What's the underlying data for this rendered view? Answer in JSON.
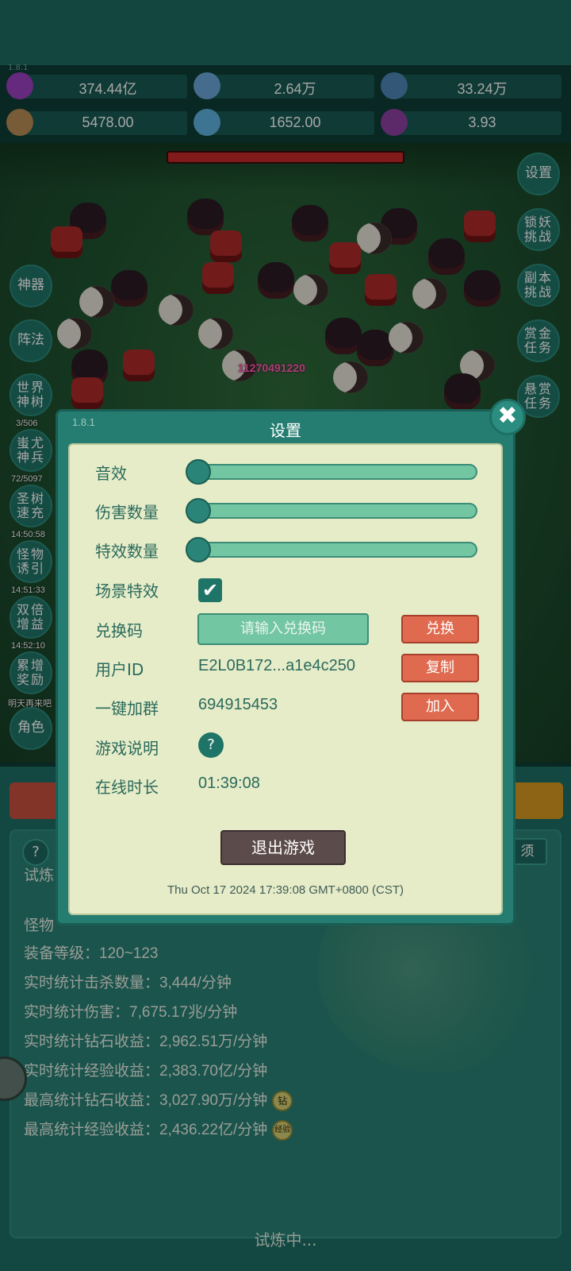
{
  "top": {
    "version": "1.8.1",
    "resources": [
      {
        "icon": "purple-gem-icon",
        "value": "374.44亿",
        "color": "#9b3fc1"
      },
      {
        "icon": "blue-crystal-icon",
        "value": "2.64万",
        "color": "#6aa6d8"
      },
      {
        "icon": "blue-orb-icon",
        "value": "33.24万",
        "color": "#4f86b5"
      },
      {
        "icon": "scroll-icon",
        "value": "5478.00",
        "color": "#b98d55"
      },
      {
        "icon": "ice-shard-icon",
        "value": "1652.00",
        "color": "#5fb3e0"
      },
      {
        "icon": "potion-icon",
        "value": "3.93",
        "color": "#8e3fa1"
      }
    ]
  },
  "field": {
    "damage_text": "11270491220",
    "boss_hp_fraction": 1.0
  },
  "left_menu": [
    {
      "label": "神器"
    },
    {
      "label": "阵法"
    },
    {
      "label": "世界神树",
      "sub": "3/506"
    },
    {
      "label": "蚩尤神兵",
      "sub": "72/5097"
    },
    {
      "label": "圣树速充",
      "sub": "14:50:58"
    },
    {
      "label": "怪物诱引",
      "sub": "14:51:33"
    },
    {
      "label": "双倍增益",
      "sub": "14:52:10"
    },
    {
      "label": "累增奖励",
      "sub": "明天再来吧"
    },
    {
      "label": "角色"
    }
  ],
  "right_menu": [
    {
      "label": "设置"
    },
    {
      "label": "锁妖挑战"
    },
    {
      "label": "副本挑战"
    },
    {
      "label": "赏金任务"
    },
    {
      "label": "悬赏任务"
    }
  ],
  "dialog": {
    "version": "1.8.1",
    "title": "设置",
    "sound_label": "音效",
    "sound_level": 0,
    "damage_count_label": "伤害数量",
    "damage_count_level": 0,
    "effect_count_label": "特效数量",
    "effect_count_level": 0,
    "scene_effect_label": "场景特效",
    "scene_effect_checked": true,
    "redeem_label": "兑换码",
    "redeem_placeholder": "请输入兑换码",
    "redeem_button": "兑换",
    "user_id_label": "用户ID",
    "user_id_value": "E2L0B172...a1e4c250",
    "copy_button": "复制",
    "join_group_label": "一键加群",
    "group_number": "694915453",
    "join_button": "加入",
    "game_help_label": "游戏说明",
    "help_symbol": "?",
    "online_time_label": "在线时长",
    "online_time_value": "01:39:08",
    "exit_button": "退出游戏",
    "timestamp": "Thu Oct 17 2024 17:39:08 GMT+0800 (CST)",
    "close_symbol": "✖",
    "check_symbol": "✔"
  },
  "bottom": {
    "help_symbol": "?",
    "right_tab": "须",
    "stats": [
      {
        "text": "试炼"
      },
      {
        "text": "怪物"
      },
      {
        "text": "装备等级：120~123"
      },
      {
        "text": "实时统计击杀数量：3,444/分钟"
      },
      {
        "text": "实时统计伤害：7,675.17兆/分钟"
      },
      {
        "text": "实时统计钻石收益：2,962.51万/分钟"
      },
      {
        "text": "实时统计经验收益：2,383.70亿/分钟"
      },
      {
        "text": "最高统计钻石收益：3,027.90万/分钟",
        "badge": "钻"
      },
      {
        "text": "最高统计经验收益：2,436.22亿/分钟",
        "badge": "经验"
      }
    ],
    "status_text": "试炼中..."
  }
}
